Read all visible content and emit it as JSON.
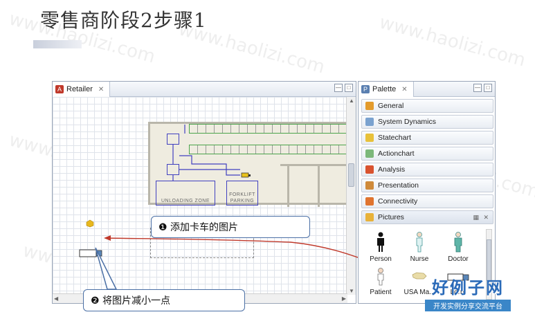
{
  "slide": {
    "title": "零售商阶段2步骤1",
    "watermark": "www.haolizi.com"
  },
  "editor": {
    "tab_label": "Retailer",
    "tab_close": "✕",
    "plan_labels": {
      "unloading_zone": "UNLOADING ZONE",
      "forklift_parking": "FORKLIFT\nPARKING"
    }
  },
  "callouts": {
    "add_truck_picture": "❶ 添加卡车的图片",
    "shrink_picture": "❷ 将图片减小一点"
  },
  "palette": {
    "tab_label": "Palette",
    "tab_close": "✕",
    "items": [
      {
        "label": "General",
        "icon": "general-icon",
        "color": "#e39b2c"
      },
      {
        "label": "System Dynamics",
        "icon": "system-dynamics-icon",
        "color": "#7aa2cf"
      },
      {
        "label": "Statechart",
        "icon": "statechart-icon",
        "color": "#e8c13a"
      },
      {
        "label": "Actionchart",
        "icon": "actionchart-icon",
        "color": "#7cb87a"
      },
      {
        "label": "Analysis",
        "icon": "analysis-icon",
        "color": "#d9532f"
      },
      {
        "label": "Presentation",
        "icon": "presentation-icon",
        "color": "#cf8a3a"
      },
      {
        "label": "Connectivity",
        "icon": "connectivity-icon",
        "color": "#e0742f"
      },
      {
        "label": "Pictures",
        "icon": "pictures-icon",
        "color": "#e8b23a"
      }
    ],
    "pictures": [
      {
        "label": "Person"
      },
      {
        "label": "Nurse"
      },
      {
        "label": "Doctor"
      },
      {
        "label": "Patient"
      },
      {
        "label": "USA Ma..."
      },
      {
        "label": "Lorry"
      }
    ]
  },
  "logo": {
    "main": "好例子网",
    "sub": "开发实例分享交流平台"
  }
}
